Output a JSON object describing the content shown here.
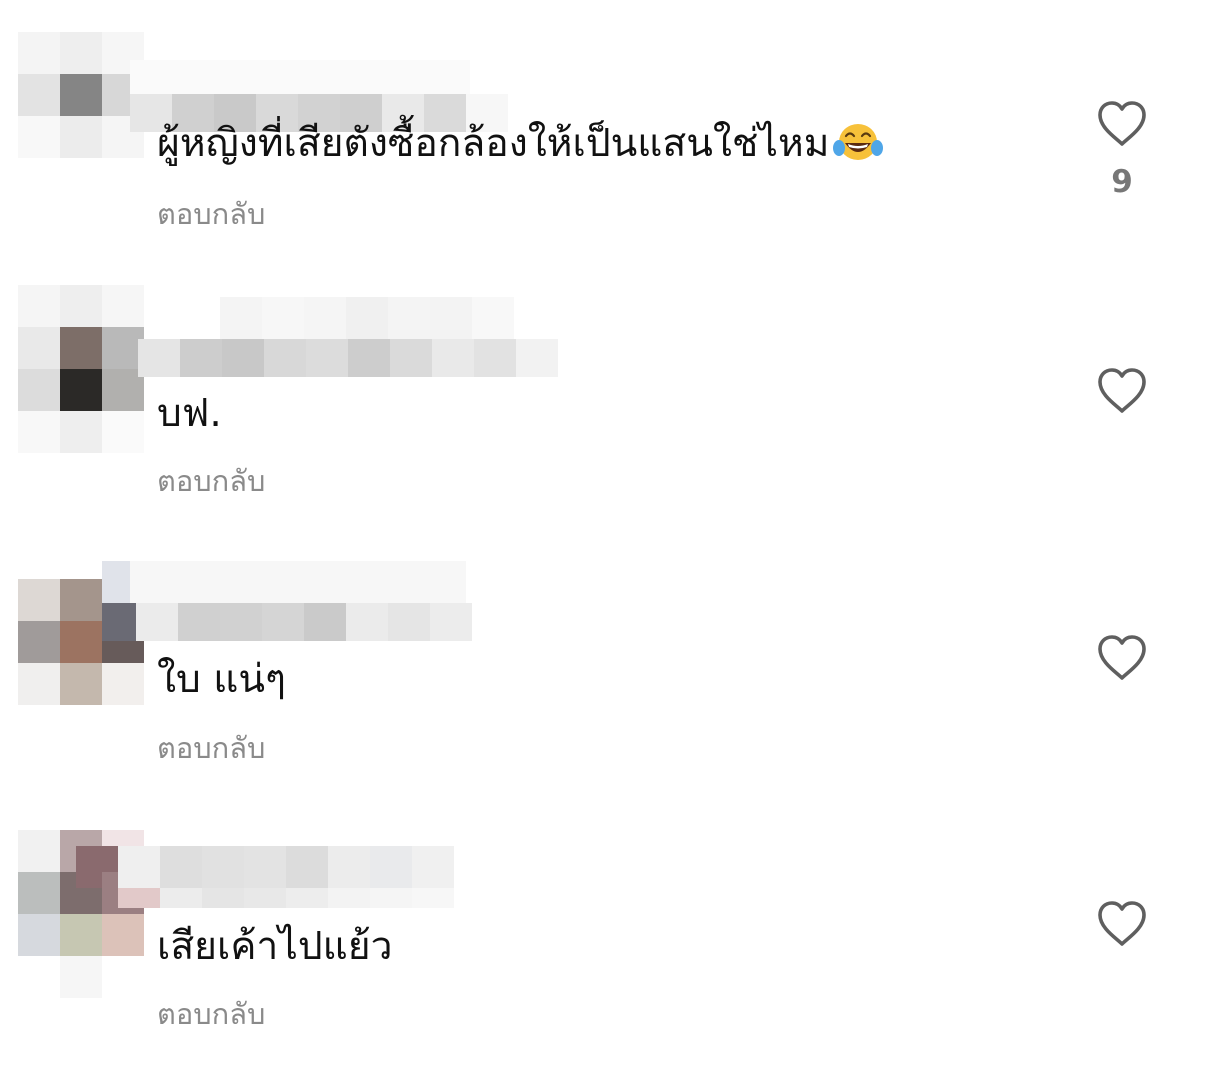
{
  "comments": [
    {
      "text": "ผู้หญิงที่เสียตังซื้อกล้องให้เป็นแสนใช่ไหม",
      "emoji": "laughing-with-tears",
      "reply_label": "ตอบกลับ",
      "like_count": "9"
    },
    {
      "text": "บฟ.",
      "reply_label": "ตอบกลับ",
      "like_count": ""
    },
    {
      "text": "ใบ แน่ๆ",
      "reply_label": "ตอบกลับ",
      "like_count": ""
    },
    {
      "text": "เสียเค้าไปแย้ว",
      "reply_label": "ตอบกลับ",
      "like_count": ""
    }
  ],
  "icons": {
    "like": "heart-outline-icon",
    "emoji": "face-with-tears-of-joy-icon"
  },
  "colors": {
    "text": "#111111",
    "secondary_text": "#8a8a8a",
    "icon_stroke": "#5f5f5f",
    "background": "#ffffff"
  }
}
